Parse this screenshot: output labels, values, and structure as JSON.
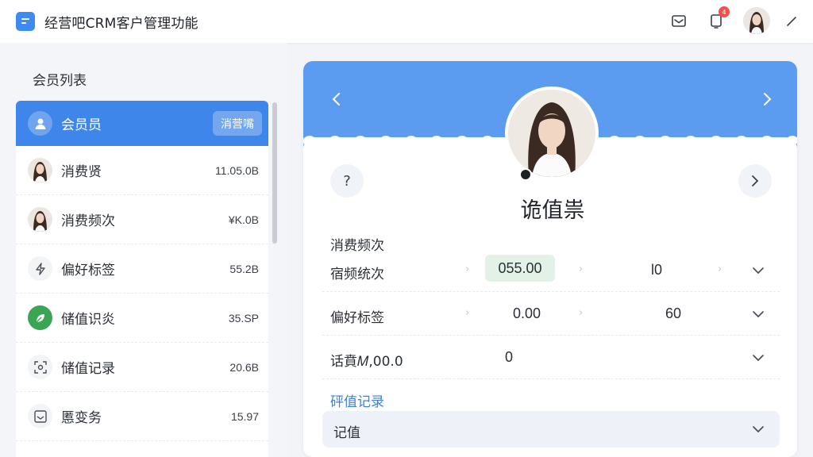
{
  "header": {
    "app_title": "经营吧CRM客户管理功能",
    "icons": [
      "logo-icon",
      "message-icon",
      "notification-icon",
      "avatar",
      "edit-icon"
    ],
    "notification_badge": "4"
  },
  "sidebar": {
    "title": "会员列表",
    "items": [
      {
        "label": "会员员",
        "chip": "消营嘴",
        "icon": "user-icon",
        "active": true
      },
      {
        "label": "消费贤",
        "value": "11.05.0B",
        "icon": "avatar"
      },
      {
        "label": "消费频次",
        "value": "¥K.0B",
        "icon": "avatar"
      },
      {
        "label": "偏好标签",
        "value": "55.2B",
        "icon": "lightning-icon"
      },
      {
        "label": "储值识炎",
        "value": "35.SP",
        "icon": "leaf-icon"
      },
      {
        "label": "储值记录",
        "value": "20.6B",
        "icon": "scan-icon"
      },
      {
        "label": "慝变务",
        "value": "15.97",
        "icon": "inbox-icon"
      }
    ]
  },
  "detail": {
    "profile_name": "诡值祟",
    "help_symbol": "?",
    "section_consumption": "消费频次",
    "fields": [
      {
        "label": "宿频统次",
        "value1": "055.00",
        "value2": "l0"
      },
      {
        "label": "偏好标签",
        "value1": "0.00",
        "value2": "60"
      },
      {
        "label": "话賁𝑀,00.0",
        "value1": "0"
      }
    ],
    "section_record": "砰值记录",
    "select_value": "记值"
  },
  "colors": {
    "accent": "#3f86ea",
    "banner": "#5b9cf0",
    "badge": "#f2514b",
    "pill": "#e3f2e6"
  }
}
